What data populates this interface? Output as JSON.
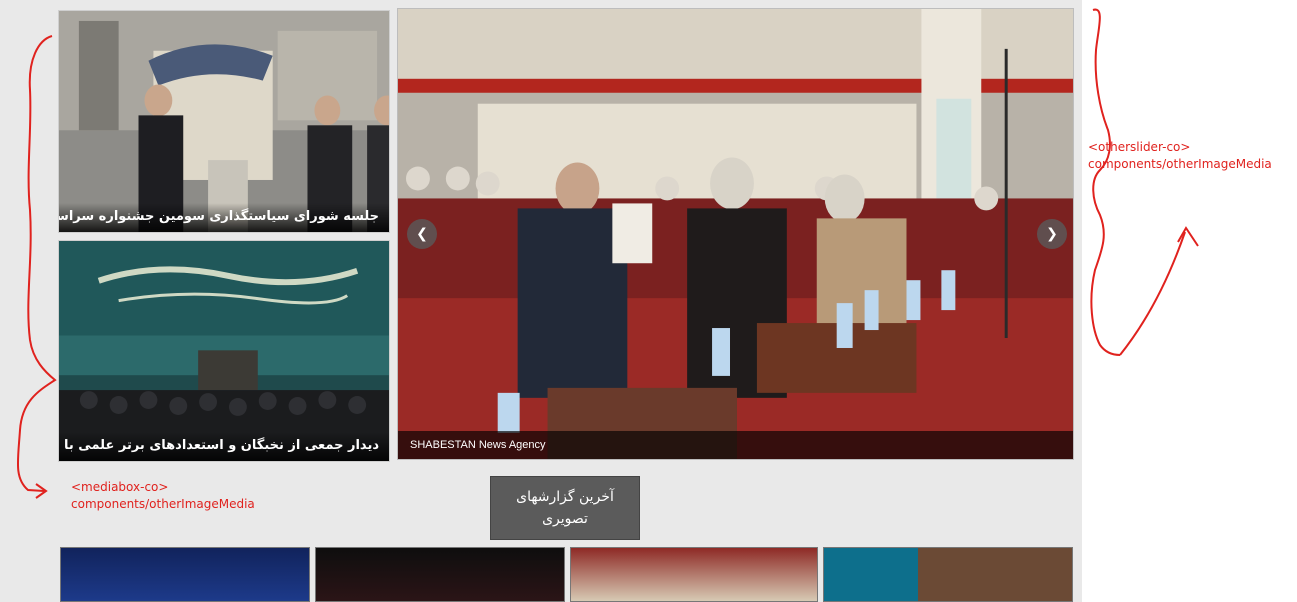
{
  "media_box": {
    "items": [
      {
        "caption": "جلسه شورای سیاستگذاری سومین جشنواره سراسری"
      },
      {
        "caption": "دیدار جمعی از نخبگان و استعدادهای برتر علمی با رهبر"
      }
    ]
  },
  "slider": {
    "credit": "SHABESTAN News Agency",
    "prev_icon": "chevron-left-icon",
    "next_icon": "chevron-right-icon"
  },
  "latest_reports_button": "آخرین گزارشهای تصویری",
  "annotations": {
    "mediabox_label": "<mediabox-co>",
    "mediabox_path": "components/otherImageMedia",
    "otherslider_label": "<otherslider-co>",
    "otherslider_path": "components/otherImageMedia"
  },
  "colors": {
    "annotation_red": "#e0221e",
    "button_bg": "#5b5b5b",
    "page_bg": "#e9e9e9"
  }
}
